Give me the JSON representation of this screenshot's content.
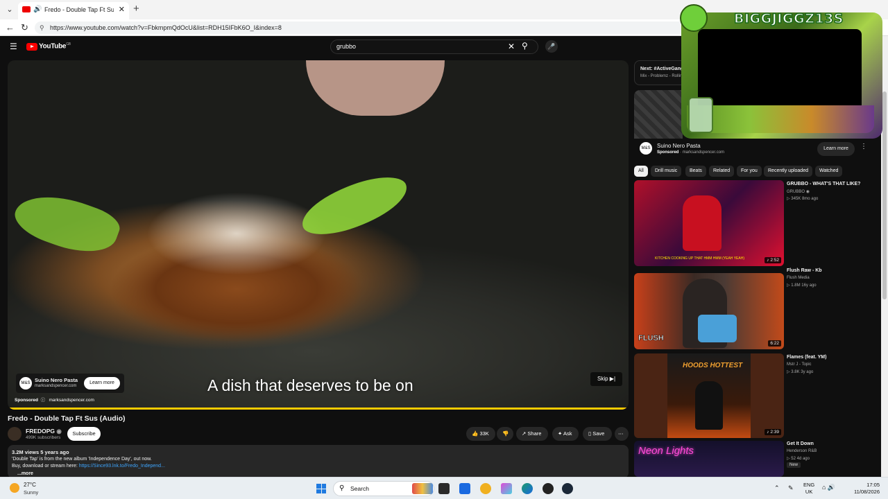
{
  "browser": {
    "tab_title": "Fredo - Double Tap Ft Sus (Au",
    "url": "https://www.youtube.com/watch?v=FbkmpmQdOcU&list=RDH15IFbK6O_I&index=8"
  },
  "youtube": {
    "logo_text": "YouTube",
    "logo_region": "GB",
    "search_value": "grubbo"
  },
  "video": {
    "caption": "A dish that deserves to be on",
    "ad": {
      "name": "Suino Nero Pasta",
      "domain": "marksandspencer.com",
      "logo": "M&S",
      "learn_more": "Learn more",
      "sponsored": "Sponsored",
      "skip": "Skip"
    }
  },
  "watch": {
    "title": "Fredo - Double Tap Ft Sus (Audio)",
    "channel": "FREDOPG",
    "subscribers": "499K subscribers",
    "subscribe": "Subscribe",
    "likes": "33K",
    "share": "Share",
    "ask": "Ask",
    "save": "Save",
    "views_date": "3.2M views  5 years ago",
    "desc_line1": "'Double Tap' is from the new album 'Independence Day', out now.",
    "desc_line2_prefix": "Buy, download or stream here: ",
    "desc_link": "https://Since93.lnk.to/Fredo_Independ...",
    "more": "...more"
  },
  "sidebar": {
    "next_title": "Next: #ActiveGang",
    "next_sub": "Mix - Problemz - Rolling",
    "ad_name": "Suino Nero Pasta",
    "ad_sponsored": "Sponsored",
    "ad_domain": "marksandspencer.com",
    "ad_learn_more": "Learn more",
    "chips": [
      "All",
      "Drill music",
      "Beats",
      "Related",
      "For you",
      "Recently uploaded",
      "Watched"
    ],
    "videos": [
      {
        "title": "GRUBBO - WHAT'S THAT LIKE?",
        "channel": "GRUBBO",
        "meta": "345K  8mo ago",
        "duration": "2:52",
        "thumb_text": "KITCHEN COOKING UP THAT HMM HMM (YEAH YEAH)"
      },
      {
        "title": "Flush Raw - Kb",
        "channel": "Flush Media",
        "meta": "1.8M  16y ago",
        "duration": "6:22",
        "thumb_text": "FLUSH"
      },
      {
        "title": "Flames (feat. YM)",
        "channel": "Mstr J - Topic",
        "meta": "3.8K  3y ago",
        "duration": "2:39",
        "thumb_text": "HOODS HOTTEST"
      },
      {
        "title": "Get It Down",
        "channel": "Henderson R&B",
        "meta": "52  4d ago",
        "badge": "New",
        "thumb_text": "Neon Lights"
      }
    ]
  },
  "overlay": {
    "title": "BIGGJIGGZ13S"
  },
  "taskbar": {
    "temp": "27°C",
    "weather": "Sunny",
    "search": "Search",
    "lang1": "ENG",
    "lang2": "UK",
    "time": "17:05",
    "date": "11/08/2026"
  },
  "colors": {
    "progress": "#ffcc00",
    "youtube_red": "#ff0000",
    "link": "#3ea6ff"
  }
}
